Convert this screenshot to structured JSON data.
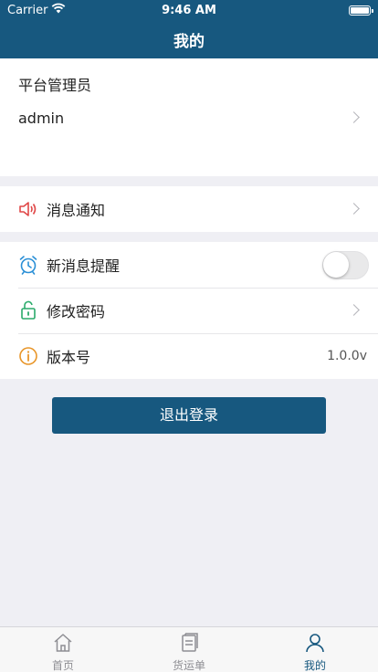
{
  "status_bar": {
    "carrier": "Carrier",
    "time": "9:46 AM"
  },
  "nav": {
    "title": "我的"
  },
  "profile": {
    "role": "平台管理员",
    "username": "admin"
  },
  "rows": {
    "notifications": {
      "label": "消息通知",
      "icon": "speaker-icon"
    },
    "new_message_alert": {
      "label": "新消息提醒",
      "icon": "alarm-clock-icon",
      "toggle_on": false
    },
    "change_password": {
      "label": "修改密码",
      "icon": "unlock-icon"
    },
    "version": {
      "label": "版本号",
      "value": "1.0.0v",
      "icon": "info-icon"
    }
  },
  "logout": {
    "label": "退出登录"
  },
  "tabs": [
    {
      "label": "首页",
      "icon": "home-icon",
      "active": false
    },
    {
      "label": "货运单",
      "icon": "document-icon",
      "active": false
    },
    {
      "label": "我的",
      "icon": "person-icon",
      "active": true
    }
  ],
  "colors": {
    "primary": "#17587f",
    "alert_red": "#e04848",
    "accent_blue": "#2a8fd6",
    "accent_green": "#2aaa6a",
    "accent_orange": "#e8962a"
  }
}
